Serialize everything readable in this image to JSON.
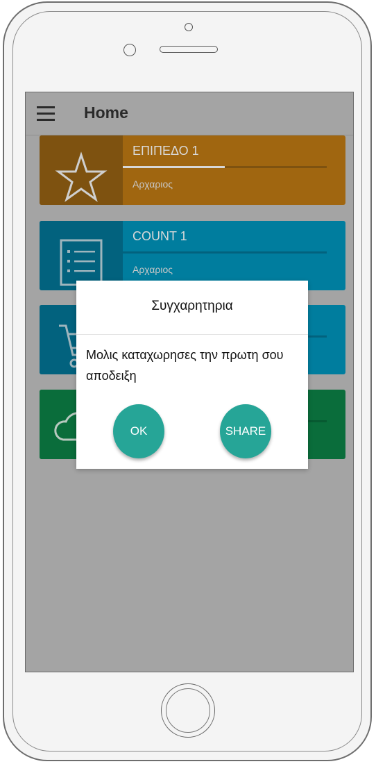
{
  "appbar": {
    "title": "Home"
  },
  "cards": [
    {
      "label": "ΕΠΙΠΕΔΟ 1",
      "sub": "Αρχαριος",
      "progress": 0.5,
      "icon": "star-icon"
    },
    {
      "label": "COUNT 1",
      "sub": "Αρχαριος",
      "progress": 0.0,
      "icon": "list-icon"
    },
    {
      "label": "",
      "sub": "",
      "progress": 0.0,
      "icon": "cart-icon"
    },
    {
      "label": "",
      "sub": "",
      "progress": 0.0,
      "icon": "cloud-icon"
    }
  ],
  "dialog": {
    "title": "Συγχαρητηρια",
    "message": "Μολις καταχωρησες την πρωτη σου αποδειξη",
    "ok_label": "OK",
    "share_label": "SHARE"
  },
  "colors": {
    "scrim": "#a4a4a4",
    "card_orange": "#a06610",
    "card_blue": "#007d9e",
    "card_green": "#0a6d3b",
    "fab": "#26a597"
  }
}
